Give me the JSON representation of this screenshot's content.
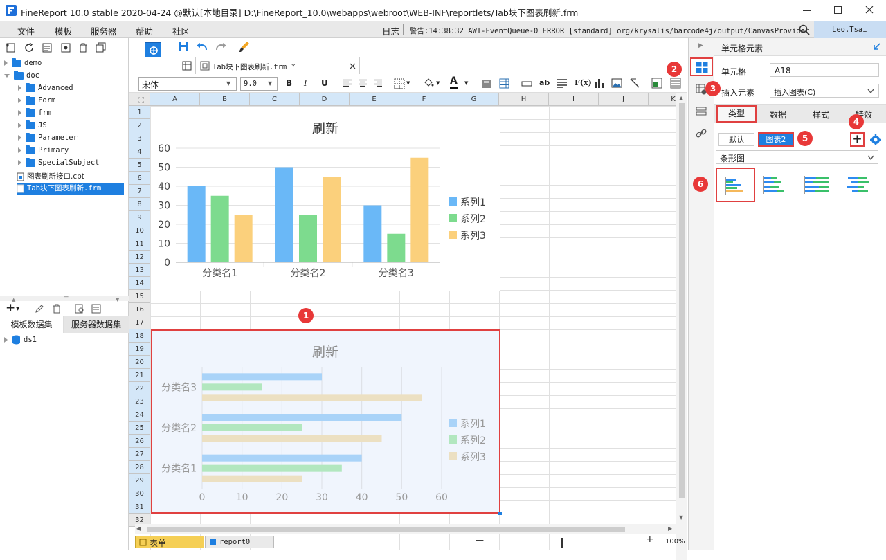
{
  "window": {
    "title": "FineReport 10.0 stable 2020-04-24 @默认[本地目录]    D:\\FineReport_10.0\\webapps\\webroot\\WEB-INF\\reportlets/Tab块下图表刷新.frm",
    "icons": {
      "minimize": "minimize-icon",
      "maximize": "maximize-icon",
      "close": "close-icon"
    }
  },
  "menubar": {
    "items": [
      "文件",
      "模板",
      "服务器",
      "帮助",
      "社区"
    ],
    "log_label": "日志",
    "warning": "警告:14:38:32 AWT-EventQueue-0 ERROR [standard] org/krysalis/barcode4j/output/CanvasProvider",
    "user": "Leo.Tsai"
  },
  "tree": {
    "items": [
      {
        "label": "demo",
        "level": 0,
        "type": "folder",
        "open": false
      },
      {
        "label": "doc",
        "level": 0,
        "type": "folder",
        "open": true
      },
      {
        "label": "Advanced",
        "level": 1,
        "type": "folder",
        "open": false
      },
      {
        "label": "Form",
        "level": 1,
        "type": "folder",
        "open": false
      },
      {
        "label": "frm",
        "level": 1,
        "type": "folder",
        "open": false
      },
      {
        "label": "JS",
        "level": 1,
        "type": "folder",
        "open": false
      },
      {
        "label": "Parameter",
        "level": 1,
        "type": "folder",
        "open": false
      },
      {
        "label": "Primary",
        "level": 1,
        "type": "folder",
        "open": false
      },
      {
        "label": "SpecialSubject",
        "level": 1,
        "type": "folder",
        "open": false
      },
      {
        "label": "图表刷新接口.cpt",
        "level": 0,
        "type": "file"
      },
      {
        "label": "Tab块下图表刷新.frm",
        "level": 0,
        "type": "file",
        "selected": true
      }
    ]
  },
  "dataset": {
    "tabs": [
      "模板数据集",
      "服务器数据集"
    ],
    "items": [
      "ds1"
    ]
  },
  "editor": {
    "tab_label": "Tab块下图表刷新.frm *",
    "font_name": "宋体",
    "font_size": "9.0",
    "format_buttons": [
      "B",
      "I",
      "U"
    ],
    "ab_label": "ab",
    "fx_label": "F(x)",
    "columns": [
      "A",
      "B",
      "C",
      "D",
      "E",
      "F",
      "G",
      "H",
      "I",
      "J",
      "K"
    ],
    "rows": [
      "1",
      "2",
      "3",
      "4",
      "5",
      "6",
      "7",
      "8",
      "9",
      "10",
      "11",
      "12",
      "13",
      "14",
      "15",
      "16",
      "17",
      "18",
      "19",
      "20",
      "21",
      "22",
      "23",
      "24",
      "25",
      "26",
      "27",
      "28",
      "29",
      "30",
      "31",
      "32"
    ],
    "sheet_tabs": [
      "表单",
      "report0"
    ],
    "zoom": "100%",
    "zoom_minus": "—",
    "zoom_plus": "+"
  },
  "chart_data": [
    {
      "type": "bar",
      "title": "刷新",
      "categories": [
        "分类名1",
        "分类名2",
        "分类名3"
      ],
      "series": [
        {
          "name": "系列1",
          "values": [
            40,
            50,
            30
          ],
          "color": "#6ab8f7"
        },
        {
          "name": "系列2",
          "values": [
            35,
            25,
            15
          ],
          "color": "#7ddb8e"
        },
        {
          "name": "系列3",
          "values": [
            25,
            45,
            55
          ],
          "color": "#fbd07c"
        }
      ],
      "ylim": [
        0,
        60
      ],
      "yticks": [
        0,
        10,
        20,
        30,
        40,
        50,
        60
      ],
      "legend": "right"
    },
    {
      "type": "bar",
      "orientation": "horizontal",
      "title": "刷新",
      "categories": [
        "分类名1",
        "分类名2",
        "分类名3"
      ],
      "series": [
        {
          "name": "系列1",
          "values": [
            40,
            50,
            30
          ],
          "color": "#a9d3f8"
        },
        {
          "name": "系列2",
          "values": [
            35,
            25,
            15
          ],
          "color": "#b2e7bf"
        },
        {
          "name": "系列3",
          "values": [
            25,
            45,
            55
          ],
          "color": "#ece0c2"
        }
      ],
      "xlim": [
        0,
        60
      ],
      "xticks": [
        0,
        10,
        20,
        30,
        40,
        50,
        60
      ],
      "legend": "right"
    }
  ],
  "right_panel": {
    "title": "单元格元素",
    "cell_label": "单元格",
    "cell_value": "A18",
    "insert_label": "插入元素",
    "insert_value": "插入图表(C)",
    "tabs": [
      "类型",
      "数据",
      "样式",
      "特效"
    ],
    "chart_tabs": [
      "默认",
      "图表2"
    ],
    "chart_type": "条形图"
  },
  "badges": [
    "1",
    "2",
    "3",
    "4",
    "5",
    "6"
  ],
  "colors": {
    "accent": "#1e7fe0",
    "selection": "#e04040",
    "header": "#dce9f7"
  }
}
